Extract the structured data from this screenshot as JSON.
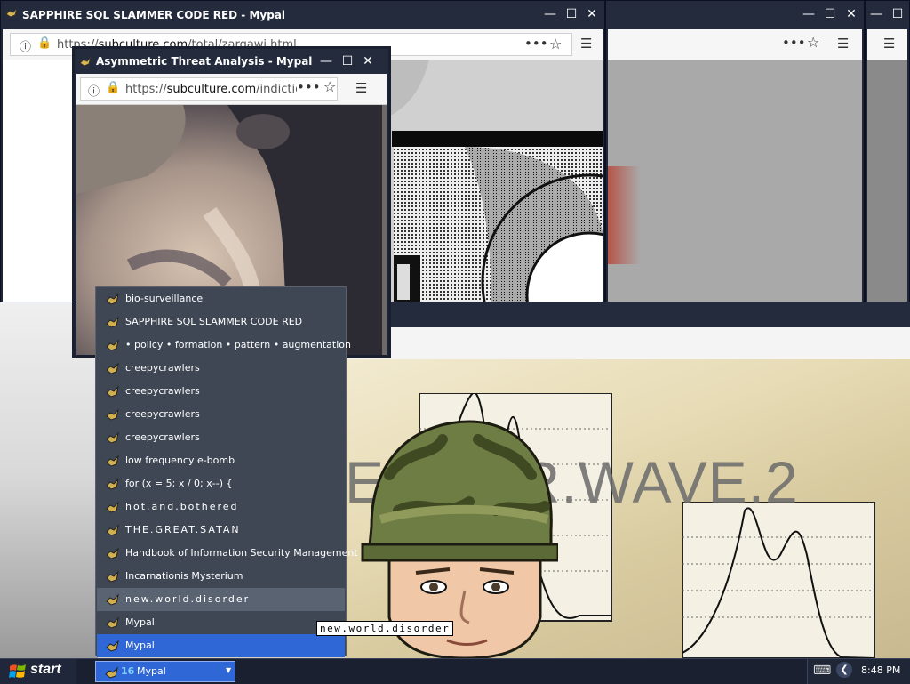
{
  "windows": {
    "back_main": {
      "title": "SAPPHIRE SQL SLAMMER CODE RED - Mypal",
      "url_prefix": "https://",
      "url_host": "subculture.com",
      "url_path": "/total/zargawi.html"
    },
    "front": {
      "title": "Asymmetric Threat Analysis - Mypal",
      "url_prefix": "https://",
      "url_host": "subculture.com",
      "url_path": "/indiction/"
    },
    "bottom": {
      "banner_text": "ERROR.WAVE.2"
    }
  },
  "menu": {
    "items": [
      {
        "label": "bio-surveillance"
      },
      {
        "label": "SAPPHIRE SQL SLAMMER CODE RED"
      },
      {
        "label": "• policy • formation • pattern • augmentation"
      },
      {
        "label": "creepycrawlers"
      },
      {
        "label": "creepycrawlers"
      },
      {
        "label": "creepycrawlers"
      },
      {
        "label": "creepycrawlers"
      },
      {
        "label": "low frequency e-bomb"
      },
      {
        "label": "for (x = 5; x / 0; x--) {"
      },
      {
        "label": "hot.and.bothered"
      },
      {
        "label": "THE.GREAT.SATAN"
      },
      {
        "label": "Handbook of Information Security Management"
      },
      {
        "label": "Incarnationis Mysterium"
      },
      {
        "label": "new.world.disorder"
      },
      {
        "label": "Mypal"
      },
      {
        "label": "Mypal"
      }
    ]
  },
  "tooltip": {
    "text": "new.world.disorder"
  },
  "taskbar": {
    "start_label": "start",
    "group_count": "16",
    "group_label": "Mypal",
    "clock": "8:48 PM"
  },
  "colors": {
    "titlebar": "#242b3d",
    "menu_bg": "#3f4755",
    "menu_hover": "#5a6372",
    "menu_active": "#2f67d6",
    "lock_green": "#12bc00",
    "taskbar": "#1b2030"
  }
}
